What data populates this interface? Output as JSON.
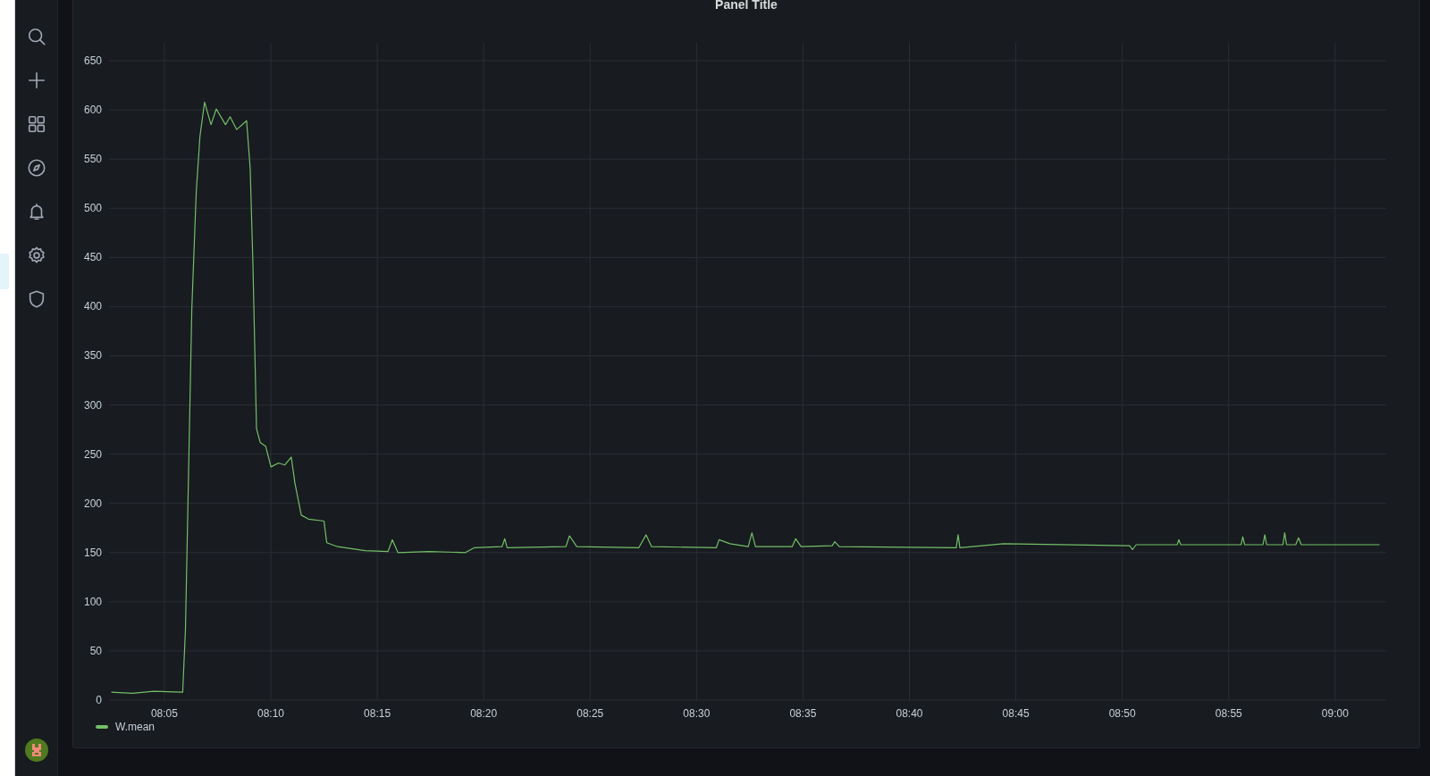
{
  "panel": {
    "title": "Panel Title",
    "chart_data": {
      "type": "line",
      "grid": true,
      "xlim": [
        482.4,
        542.4
      ],
      "ylim": [
        0,
        650
      ],
      "yticks": [
        0,
        50,
        100,
        150,
        200,
        250,
        300,
        350,
        400,
        450,
        500,
        550,
        600,
        650
      ],
      "xticks": [
        {
          "value": 485,
          "label": "08:05"
        },
        {
          "value": 490,
          "label": "08:10"
        },
        {
          "value": 495,
          "label": "08:15"
        },
        {
          "value": 500,
          "label": "08:20"
        },
        {
          "value": 505,
          "label": "08:25"
        },
        {
          "value": 510,
          "label": "08:30"
        },
        {
          "value": 515,
          "label": "08:35"
        },
        {
          "value": 520,
          "label": "08:40"
        },
        {
          "value": 525,
          "label": "08:45"
        },
        {
          "value": 530,
          "label": "08:50"
        },
        {
          "value": 535,
          "label": "08:55"
        },
        {
          "value": 540,
          "label": "09:00"
        }
      ],
      "x": [
        482.51,
        483.5,
        484.5,
        485.86,
        485.99,
        486.29,
        486.5,
        486.67,
        486.89,
        487.19,
        487.44,
        487.87,
        488.09,
        488.39,
        488.86,
        489.03,
        489.16,
        489.33,
        489.5,
        489.76,
        490.01,
        490.36,
        490.66,
        490.96,
        491.13,
        491.43,
        491.77,
        492.5,
        492.63,
        493.14,
        494.43,
        495.5,
        495.71,
        495.97,
        497.43,
        499.14,
        499.57,
        500.86,
        500.99,
        501.1,
        503.86,
        504.03,
        504.37,
        507.29,
        507.63,
        507.89,
        510.93,
        511.06,
        511.57,
        512.43,
        512.6,
        512.77,
        514.49,
        514.66,
        514.91,
        516.37,
        516.5,
        516.71,
        522.2,
        522.29,
        522.37,
        524.43,
        530.35,
        530.48,
        530.65,
        532.58,
        532.66,
        532.75,
        535.58,
        535.66,
        535.75,
        536.61,
        536.7,
        536.78,
        537.55,
        537.63,
        537.72,
        538.15,
        538.28,
        538.41,
        542.09
      ],
      "series": [
        {
          "name": "W.mean",
          "color": "#73bf69",
          "values": [
            8,
            7,
            9,
            8,
            72,
            397,
            517,
            573,
            608,
            585,
            601,
            585,
            593,
            580,
            589,
            541,
            443,
            276,
            262,
            258,
            237,
            241,
            239,
            247,
            221,
            188,
            184,
            182,
            160,
            156,
            152,
            151,
            163,
            150,
            151,
            150,
            155,
            156,
            164,
            155,
            156,
            167,
            156,
            155,
            168,
            156,
            155,
            163,
            159,
            156,
            170,
            156,
            156,
            164,
            156,
            157,
            161,
            156,
            155,
            168,
            155,
            159,
            157,
            153,
            158,
            158,
            163,
            158,
            158,
            166,
            158,
            158,
            168,
            158,
            158,
            170,
            158,
            158,
            165,
            158,
            158
          ]
        }
      ]
    }
  }
}
